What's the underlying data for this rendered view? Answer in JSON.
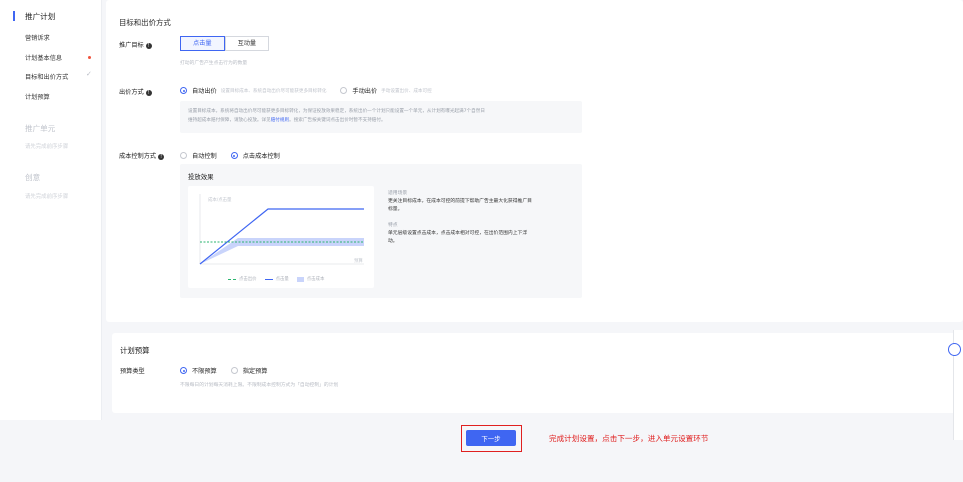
{
  "sidebar": {
    "groups": [
      {
        "title": "推广计划",
        "items": [
          {
            "label": "营销诉求"
          },
          {
            "label": "计划基本信息"
          },
          {
            "label": "目标和出价方式"
          },
          {
            "label": "计划预算"
          }
        ]
      },
      {
        "title": "推广单元",
        "hint": "请先完成前序步骤"
      },
      {
        "title": "创意",
        "hint": "请先完成前序步骤"
      }
    ],
    "accent_color": "#3f66f2",
    "error_dot_color": "#f0523c",
    "done_icon": "check-icon"
  },
  "bid_section": {
    "title": "目标和出价方式",
    "goal": {
      "label": "推广目标",
      "options": [
        "点击量",
        "互动量"
      ],
      "selected": "点击量",
      "hint": "打动的广告产生点击行为的数量"
    },
    "bid_method": {
      "label": "出价方式",
      "options": [
        {
          "label": "自动出价",
          "sub": "设置目标成本、系统自动出价尽可能获更多目标转化",
          "selected": true
        },
        {
          "label": "手动出价",
          "sub": "手动设置出价、成本可控",
          "selected": false
        }
      ],
      "description": {
        "line1": "设置目标成本，系统将自动出价尽可能获更多目标转化，为保证投放效果稳定，系统出价一个计划只能设置一个单元，从计划有曝光起满7个自然日",
        "line2_pre": "维持超成本赔付保障，请放心投放。详见",
        "line2_link": "赔付规则",
        "line2_post": "。搜索广告按关键词点击出价时暂不支持赔付。"
      }
    },
    "cost_control": {
      "label": "成本控制方式",
      "options": [
        {
          "label": "自动控制",
          "selected": false
        },
        {
          "label": "点击成本控制",
          "selected": true
        }
      ]
    },
    "effect": {
      "title": "投放效果",
      "scenario_title": "适用场景",
      "scenario_line1": "更关注目标成本，在成本可控的前提下帮助广告主最大化获得推广目",
      "scenario_line2": "标量。",
      "feature_title": "特点",
      "feature_line1": "单元层级设置点击成本，点击成本相对可控，在出价范围内上下浮",
      "feature_line2": "动。"
    }
  },
  "chart_data": {
    "type": "line",
    "ylabel": "成本/点击量",
    "xlabel": "预算",
    "series": [
      {
        "name": "点击出价",
        "style": "dashed",
        "color": "#2bb56f"
      },
      {
        "name": "点击量",
        "style": "line",
        "color": "#3f66f2"
      },
      {
        "name": "点击成本",
        "style": "area",
        "color": "#c9d4fb"
      }
    ],
    "grid": false,
    "legend": "bottom"
  },
  "budget_section": {
    "title": "计划预算",
    "label": "预算类型",
    "options": [
      {
        "label": "不限预算",
        "selected": true
      },
      {
        "label": "指定预算",
        "selected": false
      }
    ],
    "hint": "不限每日的计划每天消耗上限。不限制成本控制方式为「自动控制」的计划"
  },
  "footer": {
    "next_label": "下一步",
    "annotation": "完成计划设置，点击下一步，进入单元设置环节",
    "annotation_color": "#e02020"
  }
}
